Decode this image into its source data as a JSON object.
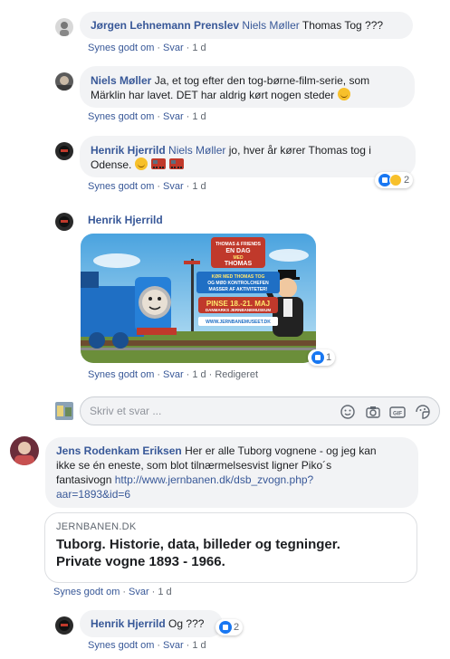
{
  "comments": [
    {
      "author": "Jørgen Lehnemann Prenslev",
      "mention": "Niels Møller",
      "text": "Thomas Tog ???",
      "actions": {
        "like": "Synes godt om",
        "reply": "Svar",
        "time": "1 d"
      }
    },
    {
      "author": "Niels Møller",
      "text1": "Ja, et tog efter den tog-børne-film-serie, som",
      "text2": "Märklin har lavet. DET har aldrig kørt nogen steder",
      "emoji": "smile-emoji",
      "actions": {
        "like": "Synes godt om",
        "reply": "Svar",
        "time": "1 d"
      }
    },
    {
      "author": "Henrik Hjerrild",
      "mention": "Niels Møller",
      "text1": "jo, hver år kører Thomas tog i",
      "text2": "Odense.",
      "emojis": [
        "smile-emoji",
        "train-emoji",
        "train-emoji"
      ],
      "reactions": {
        "count": "2",
        "types": [
          "like",
          "haha"
        ]
      },
      "actions": {
        "like": "Synes godt om",
        "reply": "Svar",
        "time": "1 d"
      }
    },
    {
      "author": "Henrik Hjerrild",
      "image": {
        "banner_top": "EN DAG",
        "banner_mid": "MED",
        "banner_bottom": "THOMAS",
        "logo": "THOMAS & FRIENDS",
        "tag_line1": "KØR MED THOMAS TOG",
        "tag_line2": "OG MØD KONTROLCHEFEN",
        "tag_line3": "MASSER AF AKTIVITETER!",
        "date": "PINSE 18.-21. MAJ",
        "venue": "DANMARKS JERNBANEMUSEUM",
        "url": "WWW.JERNBANEMUSEET.DK"
      },
      "reactions": {
        "count": "1",
        "types": [
          "like"
        ]
      },
      "actions": {
        "like": "Synes godt om",
        "reply": "Svar",
        "time": "1 d",
        "edited": "Redigeret"
      }
    }
  ],
  "reply_box": {
    "placeholder": "Skriv et svar ...",
    "icons": [
      "emoji-icon",
      "camera-icon",
      "gif-icon",
      "sticker-icon"
    ]
  },
  "main_comment": {
    "author": "Jens Rodenkam Eriksen",
    "text1": "Her er alle Tuborg vognene - og jeg kan",
    "text2": "ikke se én eneste, som blot tilnærmelsesvist ligner Piko´s",
    "text3": "fantasivogn",
    "link1": "http://www.jernbanen.dk/dsb_zvogn.php?",
    "link2": "aar=1893&id=6",
    "card": {
      "domain": "JERNBANEN.DK",
      "title1": "Tuborg. Historie, data, billeder og tegninger.",
      "title2": "Private vogne 1893 - 1966."
    },
    "actions": {
      "like": "Synes godt om",
      "reply": "Svar",
      "time": "1 d"
    }
  },
  "last_reply": {
    "author": "Henrik Hjerrild",
    "text": "Og ???",
    "reactions": {
      "count": "2",
      "types": [
        "like"
      ]
    },
    "actions": {
      "like": "Synes godt om",
      "reply": "Svar",
      "time": "1 d"
    }
  },
  "colors": {
    "link": "#385898",
    "bubble": "#f2f3f5",
    "meta": "#606770",
    "like": "#1877f2"
  }
}
